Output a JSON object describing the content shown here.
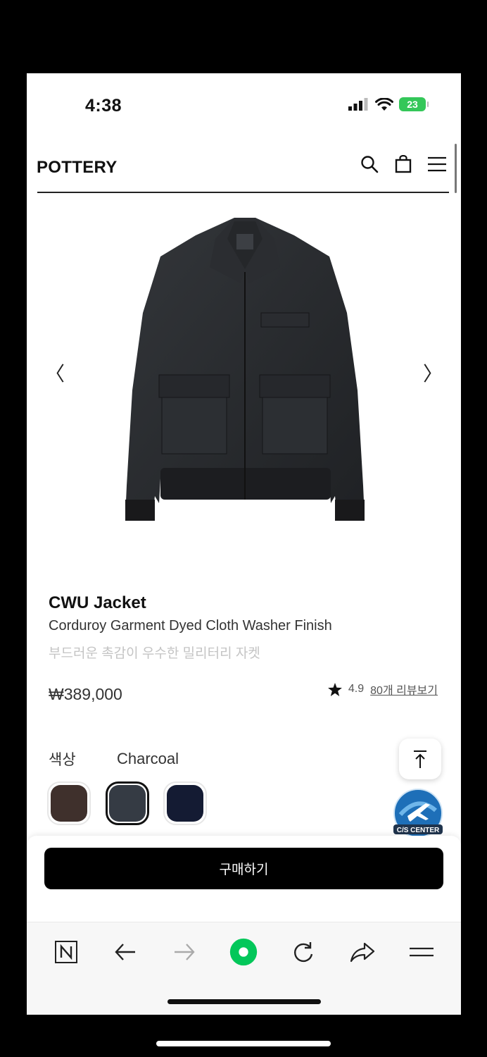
{
  "status_bar": {
    "time": "4:38",
    "battery": "23"
  },
  "header": {
    "brand": "POTTERY"
  },
  "icons": {
    "search": "search-icon",
    "bag": "shopping-bag-icon",
    "menu": "hamburger-menu-icon",
    "prev": "chevron-left-icon",
    "next": "chevron-right-icon",
    "star": "star-icon",
    "top": "scroll-top-icon",
    "cs": "cs-center-icon"
  },
  "carousel": {
    "prev_glyph": "〈",
    "next_glyph": "〉"
  },
  "product": {
    "name": "CWU Jacket",
    "subtitle": "Corduroy Garment Dyed Cloth Washer Finish",
    "description_kr": "부드러운 촉감이 우수한 밀리터리 자켓",
    "price": "₩389,000",
    "rating": "4.9",
    "reviews_link": "80개 리뷰보기"
  },
  "color_option": {
    "label": "색상",
    "selected": "Charcoal",
    "swatches": [
      {
        "name": "Brown",
        "hex": "#3f302c"
      },
      {
        "name": "Charcoal",
        "hex": "#353b44"
      },
      {
        "name": "Navy",
        "hex": "#141b33"
      }
    ]
  },
  "cs_badge": {
    "label": "C/S CENTER"
  },
  "purchase": {
    "buy_label": "구매하기"
  },
  "colors": {
    "accent_green": "#03c75a",
    "button_black": "#000000"
  }
}
